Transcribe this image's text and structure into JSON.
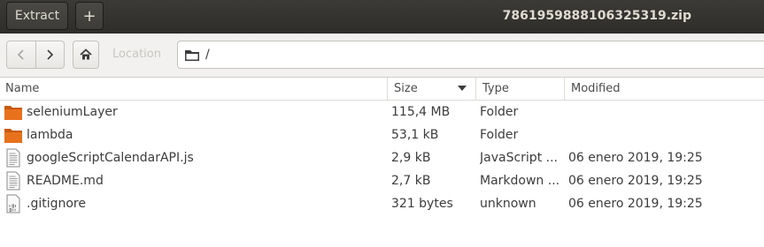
{
  "headerbar": {
    "extract_label": "Extract",
    "new_label": "+",
    "title": "7861959888106325319.zip"
  },
  "toolbar": {
    "location_label": "Location",
    "path": "/"
  },
  "columns": {
    "name": "Name",
    "size": "Size",
    "type": "Type",
    "modified": "Modified"
  },
  "files": [
    {
      "name": "seleniumLayer",
      "size": "115,4 MB",
      "type": "Folder",
      "modified": "",
      "icon": "folder-icon"
    },
    {
      "name": "lambda",
      "size": "53,1 kB",
      "type": "Folder",
      "modified": "",
      "icon": "folder-icon"
    },
    {
      "name": "googleScriptCalendarAPI.js",
      "size": "2,9 kB",
      "type": "JavaScript ...",
      "modified": "06 enero 2019, 19:25",
      "icon": "text-file-icon"
    },
    {
      "name": "README.md",
      "size": "2,7 kB",
      "type": "Markdown ...",
      "modified": "06 enero 2019, 19:25",
      "icon": "text-file-icon"
    },
    {
      "name": ".gitignore",
      "size": "321 bytes",
      "type": "unknown",
      "modified": "06 enero 2019, 19:25",
      "icon": "binary-file-icon"
    }
  ],
  "colors": {
    "headerbar_bg": "#2e2d2a",
    "folder_orange": "#e8711c",
    "toolbar_bg": "#f2f1ef"
  }
}
